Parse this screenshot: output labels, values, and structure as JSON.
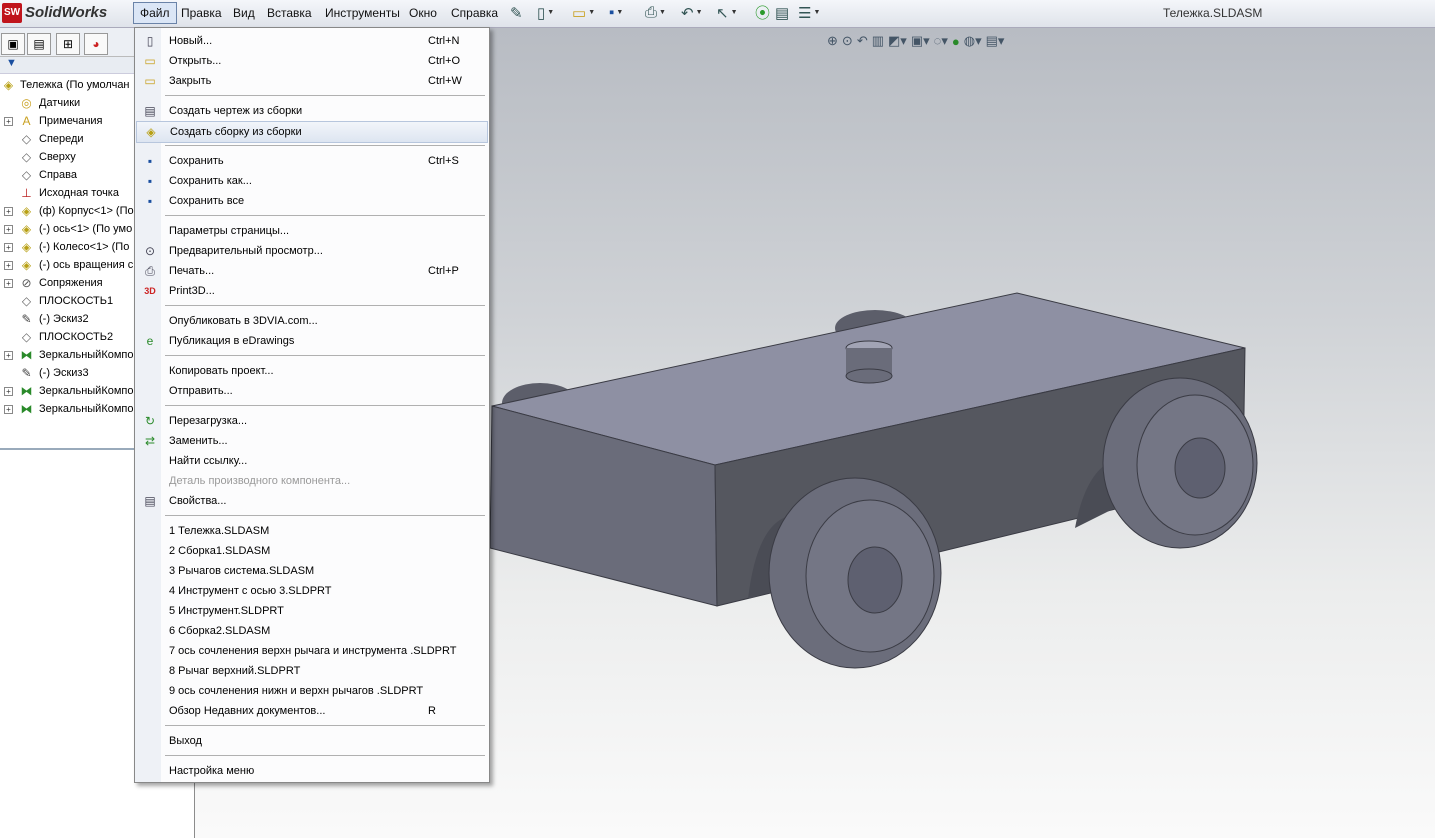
{
  "app": {
    "logo_text": "SolidWorks",
    "logo_badge": "SW",
    "document_title": "Тележка.SLDASM"
  },
  "menubar": [
    {
      "label": "Файл",
      "active": true
    },
    {
      "label": "Правка"
    },
    {
      "label": "Вид"
    },
    {
      "label": "Вставка"
    },
    {
      "label": "Инструменты"
    },
    {
      "label": "Окно"
    },
    {
      "label": "Справка"
    }
  ],
  "toolbar_icons": [
    "pin-icon",
    "new-document-icon",
    "open-folder-icon",
    "save-icon",
    "print-icon",
    "undo-icon",
    "select-cursor-icon",
    "rebuild-traffic-light-icon",
    "file-properties-icon",
    "options-icon"
  ],
  "feature_tree": {
    "root": "Тележка  (По умолчан",
    "items": [
      {
        "label": "Датчики",
        "icon": "sensor-icon",
        "expandable": false
      },
      {
        "label": "Примечания",
        "icon": "annotations-icon",
        "expandable": true
      },
      {
        "label": "Спереди",
        "icon": "plane-icon",
        "expandable": false
      },
      {
        "label": "Сверху",
        "icon": "plane-icon",
        "expandable": false
      },
      {
        "label": "Справа",
        "icon": "plane-icon",
        "expandable": false
      },
      {
        "label": "Исходная точка",
        "icon": "origin-icon",
        "expandable": false
      },
      {
        "label": "(ф) Корпус<1> (По",
        "icon": "part-icon",
        "expandable": true
      },
      {
        "label": "(-) ось<1> (По умо",
        "icon": "part-icon",
        "expandable": true
      },
      {
        "label": "(-) Колесо<1> (По",
        "icon": "part-icon",
        "expandable": true
      },
      {
        "label": "(-) ось вращения с",
        "icon": "part-icon",
        "expandable": true
      },
      {
        "label": "Сопряжения",
        "icon": "mates-icon",
        "expandable": true
      },
      {
        "label": "ПЛОСКОСТЬ1",
        "icon": "plane-icon",
        "expandable": false
      },
      {
        "label": "(-) Эскиз2",
        "icon": "sketch-icon",
        "expandable": false
      },
      {
        "label": "ПЛОСКОСТЬ2",
        "icon": "plane-icon",
        "expandable": false
      },
      {
        "label": "ЗеркальныйКомпо",
        "icon": "mirror-component-icon",
        "expandable": true
      },
      {
        "label": "(-) Эскиз3",
        "icon": "sketch-icon",
        "expandable": false
      },
      {
        "label": "ЗеркальныйКомпо",
        "icon": "mirror-component-icon",
        "expandable": true
      },
      {
        "label": "ЗеркальныйКомпо",
        "icon": "mirror-component-icon",
        "expandable": true
      }
    ]
  },
  "file_menu": {
    "groups": [
      [
        {
          "label": "Новый...",
          "shortcut": "Ctrl+N",
          "icon": "new-document-icon"
        },
        {
          "label": "Открыть...",
          "shortcut": "Ctrl+O",
          "icon": "open-folder-icon"
        },
        {
          "label": "Закрыть",
          "shortcut": "Ctrl+W",
          "icon": "close-folder-icon"
        }
      ],
      [
        {
          "label": "Создать чертеж из сборки",
          "icon": "drawing-from-assembly-icon"
        },
        {
          "label": "Создать сборку из сборки",
          "icon": "assembly-from-assembly-icon",
          "hover": true
        }
      ],
      [
        {
          "label": "Сохранить",
          "shortcut": "Ctrl+S",
          "icon": "save-icon"
        },
        {
          "label": "Сохранить как...",
          "icon": "save-as-icon"
        },
        {
          "label": "Сохранить все",
          "icon": "save-all-icon"
        }
      ],
      [
        {
          "label": "Параметры страницы..."
        },
        {
          "label": "Предварительный просмотр...",
          "icon": "print-preview-icon"
        },
        {
          "label": "Печать...",
          "shortcut": "Ctrl+P",
          "icon": "print-icon"
        },
        {
          "label": "Print3D...",
          "icon": "print3d-icon"
        }
      ],
      [
        {
          "label": "Опубликовать в 3DVIA.com..."
        },
        {
          "label": "Публикация в eDrawings",
          "icon": "edrawings-icon"
        }
      ],
      [
        {
          "label": "Копировать проект..."
        },
        {
          "label": "Отправить..."
        }
      ],
      [
        {
          "label": "Перезагрузка...",
          "icon": "reload-icon"
        },
        {
          "label": "Заменить...",
          "icon": "replace-icon"
        },
        {
          "label": "Найти ссылку..."
        },
        {
          "label": "Деталь производного компонента...",
          "disabled": true
        },
        {
          "label": "Свойства...",
          "icon": "properties-icon"
        }
      ],
      [
        {
          "label": "1 Тележка.SLDASM"
        },
        {
          "label": "2 Сборка1.SLDASM"
        },
        {
          "label": "3 Рычагов система.SLDASM"
        },
        {
          "label": "4 Инструмент с осью 3.SLDPRT"
        },
        {
          "label": "5 Инструмент.SLDPRT"
        },
        {
          "label": "6 Сборка2.SLDASM"
        },
        {
          "label": "7 ось  сочленения верхн рычага и инструмента .SLDPRT"
        },
        {
          "label": "8 Рычаг верхний.SLDPRT"
        },
        {
          "label": "9 ось сочленения нижн и верхн рычагов .SLDPRT"
        },
        {
          "label": "Обзор Недавних документов...",
          "shortcut": "R"
        }
      ],
      [
        {
          "label": "Выход"
        }
      ],
      [
        {
          "label": "Настройка меню"
        }
      ]
    ]
  },
  "colors": {
    "body": "#5a5c68",
    "body_top": "#8e90a3",
    "wheel": "#6b6d7b",
    "menu_hover": "#dde5f1"
  }
}
